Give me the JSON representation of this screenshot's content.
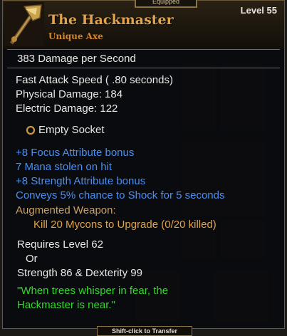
{
  "header": {
    "equipped_tab": "Equipped",
    "name": "The Hackmaster",
    "type": "Unique Axe",
    "level": "Level 55",
    "icon": "axe-icon"
  },
  "stats": {
    "dps": "383  Damage per Second",
    "attack_speed": "Fast Attack Speed ( .80 seconds)",
    "physical": "Physical Damage: 184",
    "electric": "Electric Damage: 122"
  },
  "socket": {
    "label": "Empty Socket",
    "icon": "socket-ring-icon"
  },
  "bonuses": [
    "+8 Focus Attribute bonus",
    "7 Mana stolen on hit",
    "+8 Strength Attribute bonus",
    "Conveys 5% chance to Shock for 5 seconds"
  ],
  "augment": {
    "title": "Augmented Weapon:",
    "task": "Kill 20 Mycons to Upgrade (0/20 killed)"
  },
  "requirements": {
    "level": "Requires Level 62",
    "or": "Or",
    "attributes": "Strength 86 & Dexterity 99"
  },
  "flavor": {
    "line1": "\"When trees whisper in fear, the",
    "line2": "Hackmaster is near.\""
  },
  "footer": {
    "transfer": "Shift-click to Transfer"
  },
  "colors": {
    "name": "#e0a24a",
    "type": "#d2842e",
    "bonus": "#4a8ef0",
    "augment_title": "#caa166",
    "augment_task": "#e0a24a",
    "flavor": "#34d82c"
  }
}
